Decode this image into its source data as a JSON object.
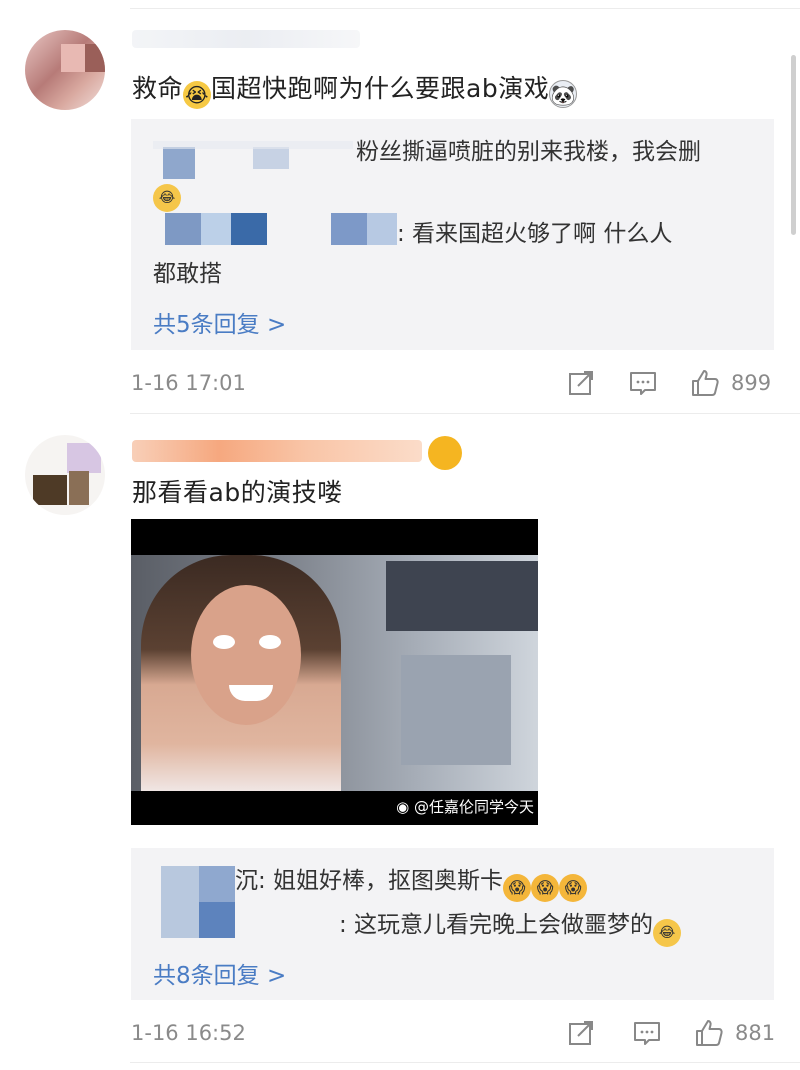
{
  "comments": [
    {
      "text": "救命",
      "text_after": "国超快跑啊为什么要跟ab演戏",
      "replies": [
        {
          "text": "粉丝撕逼喷脏的别来我楼，我会删"
        },
        {
          "text": ": 看来国超火够了啊  什么人",
          "text_line2": "都敢搭"
        }
      ],
      "reply_count_label": "共5条回复 >",
      "time": "1-16 17:01",
      "likes": "899"
    },
    {
      "text": "那看看ab的演技喽",
      "image_watermark": "@任嘉伦同学今天",
      "replies": [
        {
          "name_tail": "沉",
          "text": ": 姐姐好棒，抠图奥斯卡"
        },
        {
          "text": ": 这玩意儿看完晚上会做噩梦的"
        }
      ],
      "reply_count_label": "共8条回复 >",
      "time": "1-16 16:52",
      "likes": "881"
    }
  ],
  "icons": {
    "cry": "loudly-crying-face-icon",
    "panda": "panda-face-icon",
    "laugh": "tears-of-joy-icon",
    "scared": "screaming-face-icon",
    "share": "share-icon",
    "comment": "comment-icon",
    "like": "thumbs-up-icon"
  },
  "colors": {
    "link": "#4a7cc4",
    "meta": "#8a8a8a",
    "reply_bg": "#f3f3f5"
  }
}
